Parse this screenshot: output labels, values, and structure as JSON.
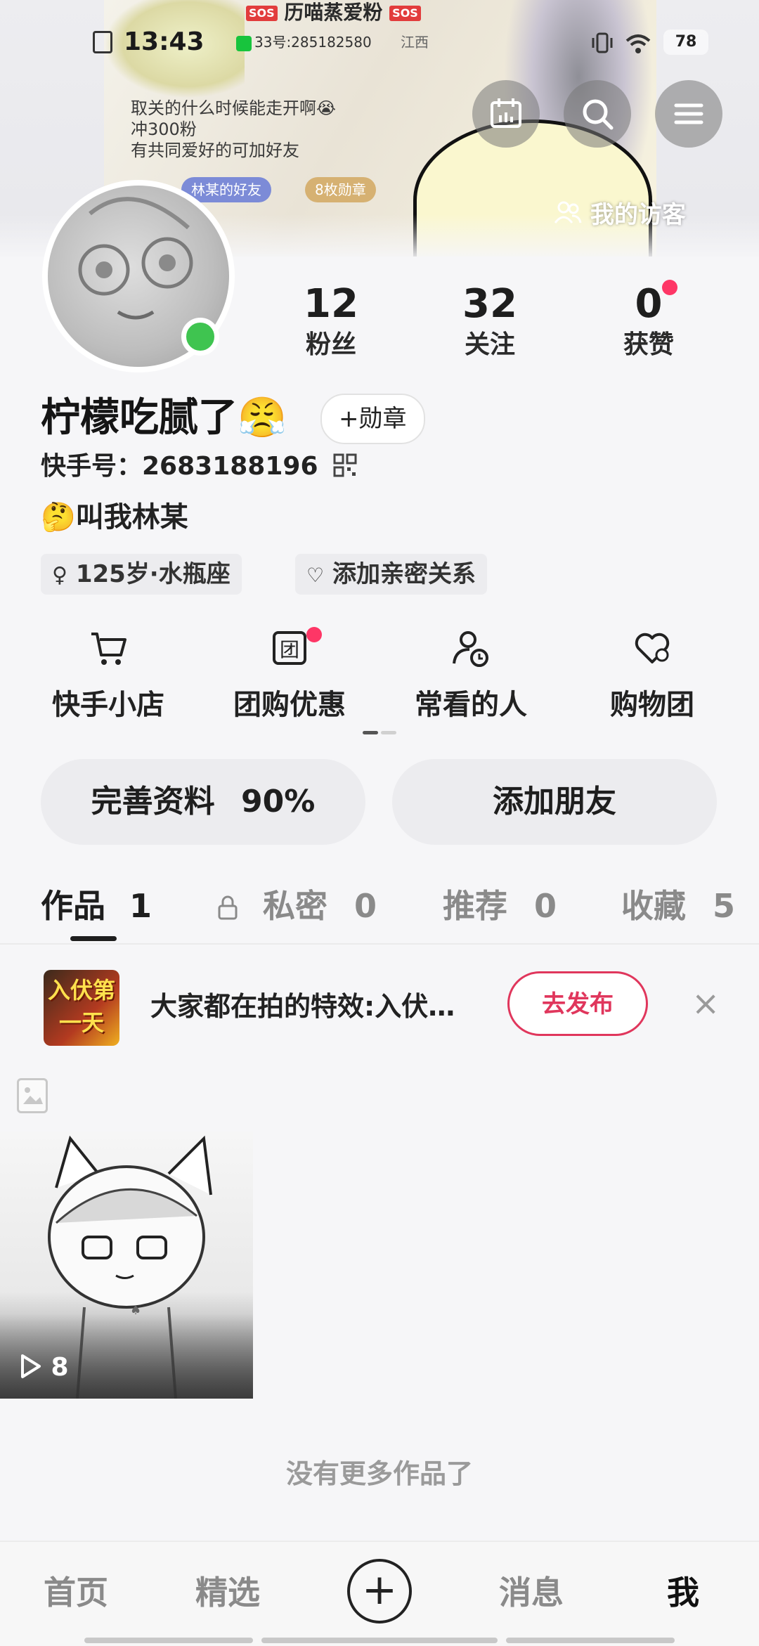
{
  "status_bar": {
    "time": "13:43",
    "room": "33号:285182580",
    "location": "江西",
    "battery": "78"
  },
  "banner": {
    "sos_label": "SOS",
    "title": "历喵蒸爱粉",
    "bio_lines": [
      "取关的什么时候能走开啊😭",
      "冲300粉",
      "有共同爱好的可加好友"
    ],
    "chip_friends": "林某的好友",
    "chip_medals": "8枚勋章"
  },
  "header": {
    "visitors_label": "我的访客"
  },
  "profile": {
    "stats": [
      {
        "num": "12",
        "label": "粉丝"
      },
      {
        "num": "32",
        "label": "关注"
      },
      {
        "num": "0",
        "label": "获赞"
      }
    ],
    "name": "柠檬吃腻了😤",
    "medal_btn": "+勋章",
    "uid": "快手号：2683188196",
    "intro": "🤔叫我林某",
    "tags": [
      "125岁·水瓶座",
      "添加亲密关系"
    ]
  },
  "shortcuts": [
    {
      "label": "快手小店",
      "icon": "cart-icon"
    },
    {
      "label": "团购优惠",
      "icon": "group-buy-icon"
    },
    {
      "label": "常看的人",
      "icon": "person-clock-icon"
    },
    {
      "label": "购物团",
      "icon": "heart-group-icon"
    }
  ],
  "actions": {
    "complete_profile": "完善资料",
    "complete_percent": "90%",
    "add_friend": "添加朋友"
  },
  "tabs": [
    {
      "label": "作品",
      "count": "1"
    },
    {
      "label": "私密",
      "count": "0"
    },
    {
      "label": "推荐",
      "count": "0"
    },
    {
      "label": "收藏",
      "count": "5"
    }
  ],
  "effect": {
    "thumb_text": "入伏第一天",
    "text": "大家都在拍的特效:入伏…",
    "button": "去发布"
  },
  "works": {
    "play_count": "8",
    "no_more": "没有更多作品了"
  },
  "bottom_nav": [
    "首页",
    "精选",
    "消息",
    "我"
  ],
  "colors": {
    "accent": "#fe3666",
    "online": "#3fc450",
    "publish": "#e0365c"
  }
}
